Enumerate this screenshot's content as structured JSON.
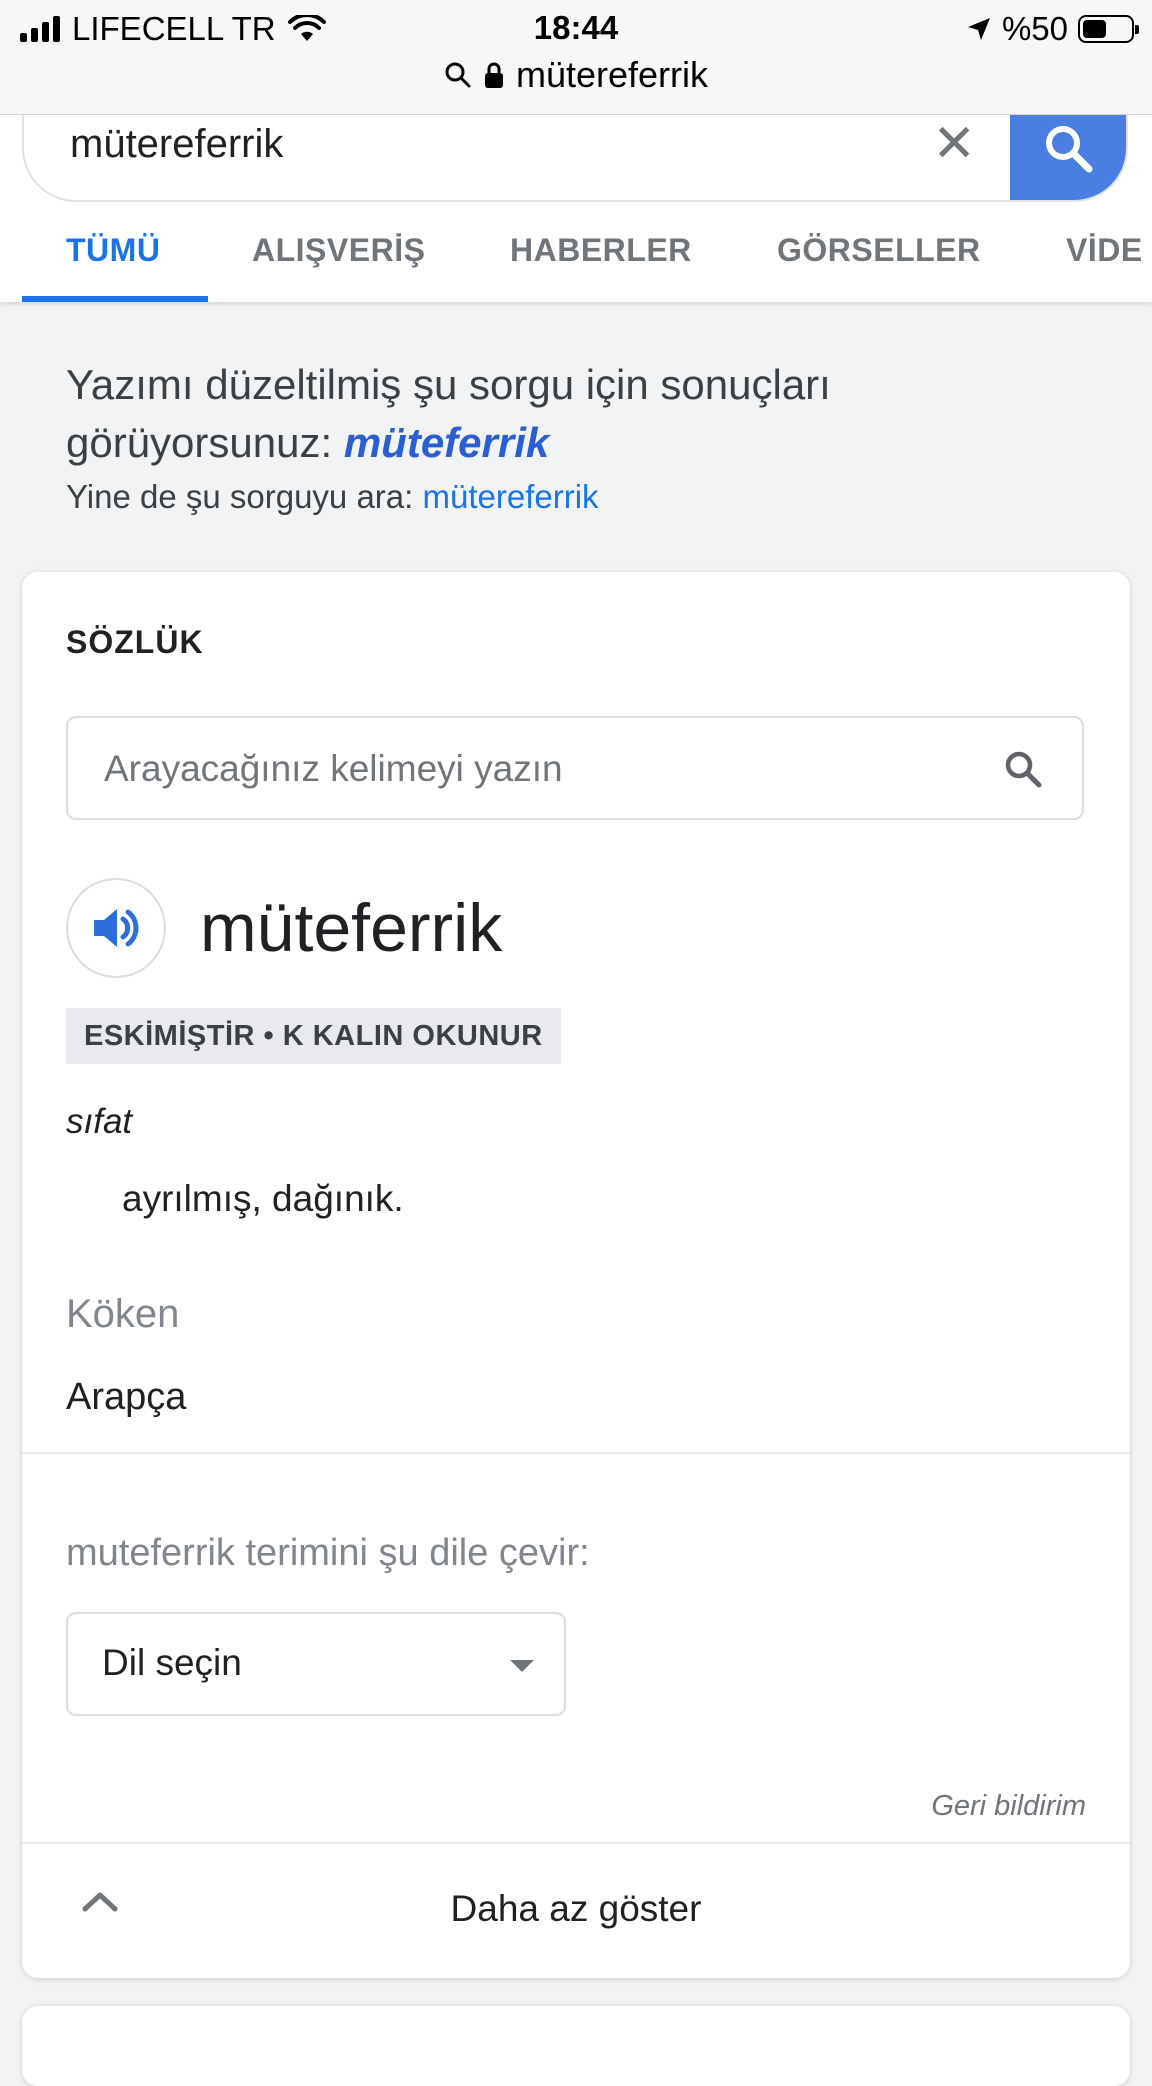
{
  "status_bar": {
    "carrier": "LIFECELL TR",
    "time": "18:44",
    "battery_percent": "%50",
    "battery_level": 0.5
  },
  "url_bar": {
    "domain": "mütereferrik"
  },
  "search": {
    "query": "mütereferrik"
  },
  "tabs": [
    {
      "label": "TÜMÜ",
      "active": true
    },
    {
      "label": "ALIŞVERİŞ",
      "active": false
    },
    {
      "label": "HABERLER",
      "active": false
    },
    {
      "label": "GÖRSELLER",
      "active": false
    },
    {
      "label": "VİDE",
      "active": false
    }
  ],
  "correction": {
    "prefix": "Yazımı düzeltilmiş şu sorgu için sonuçları görüyorsunuz:",
    "corrected": "müteferrik",
    "instead_prefix": "Yine de şu sorguyu ara:",
    "original": "mütereferrik"
  },
  "dictionary": {
    "title": "SÖZLÜK",
    "input_placeholder": "Arayacağınız kelimeyi yazın",
    "word": "müteferrik",
    "tag": "ESKİMİŞTİR • K KALIN OKUNUR",
    "part_of_speech": "sıfat",
    "meaning": "ayrılmış, dağınık.",
    "origin_heading": "Köken",
    "origin_value": "Arapça",
    "translate_label": "muteferrik terimini şu dile çevir:",
    "language_select": "Dil seçin",
    "feedback": "Geri bildirim",
    "show_less": "Daha az göster"
  },
  "colors": {
    "accent": "#1a73e8",
    "search_button": "#4a7ee0"
  }
}
